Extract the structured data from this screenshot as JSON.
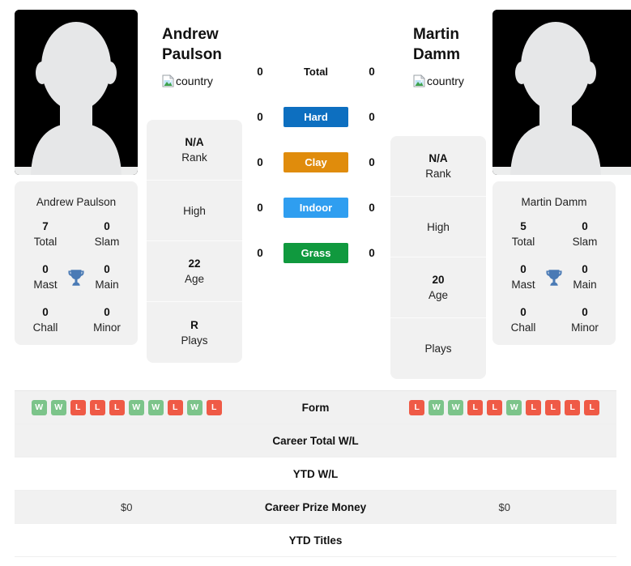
{
  "colors": {
    "hard": "#0d6fc0",
    "clay": "#e08c0c",
    "indoor": "#2f9ef0",
    "grass": "#10993e",
    "win": "#7cc48a",
    "loss": "#ef5a46",
    "trophy": "#4a7ab5",
    "card_bg": "#f1f1f1"
  },
  "players": {
    "left": {
      "name_line1": "Andrew",
      "name_line2": "Paulson",
      "flag_alt": "country",
      "card_name": "Andrew Paulson",
      "titles": [
        {
          "value": "7",
          "label": "Total"
        },
        {
          "value": "0",
          "label": "Slam"
        },
        {
          "value": "0",
          "label": "Mast"
        },
        {
          "value": "0",
          "label": "Main"
        },
        {
          "value": "0",
          "label": "Chall"
        },
        {
          "value": "0",
          "label": "Minor"
        }
      ],
      "info": [
        {
          "value": "N/A",
          "label": "Rank"
        },
        {
          "value": "",
          "label": "High"
        },
        {
          "value": "22",
          "label": "Age"
        },
        {
          "value": "R",
          "label": "Plays"
        }
      ],
      "form": [
        "W",
        "W",
        "L",
        "L",
        "L",
        "W",
        "W",
        "L",
        "W",
        "L"
      ],
      "career_total_wl": "",
      "ytd_wl": "",
      "career_prize_money": "$0",
      "ytd_titles": ""
    },
    "right": {
      "name_line1": "Martin",
      "name_line2": "Damm",
      "flag_alt": "country",
      "card_name": "Martin Damm",
      "titles": [
        {
          "value": "5",
          "label": "Total"
        },
        {
          "value": "0",
          "label": "Slam"
        },
        {
          "value": "0",
          "label": "Mast"
        },
        {
          "value": "0",
          "label": "Main"
        },
        {
          "value": "0",
          "label": "Chall"
        },
        {
          "value": "0",
          "label": "Minor"
        }
      ],
      "info": [
        {
          "value": "N/A",
          "label": "Rank"
        },
        {
          "value": "",
          "label": "High"
        },
        {
          "value": "20",
          "label": "Age"
        },
        {
          "value": "",
          "label": "Plays"
        }
      ],
      "form": [
        "L",
        "W",
        "W",
        "L",
        "L",
        "W",
        "L",
        "L",
        "L",
        "L"
      ],
      "career_total_wl": "",
      "ytd_wl": "",
      "career_prize_money": "$0",
      "ytd_titles": ""
    }
  },
  "surfaces": [
    {
      "label": "Total",
      "left": "0",
      "right": "0",
      "style": "plain"
    },
    {
      "label": "Hard",
      "left": "0",
      "right": "0",
      "style": "hard"
    },
    {
      "label": "Clay",
      "left": "0",
      "right": "0",
      "style": "clay"
    },
    {
      "label": "Indoor",
      "left": "0",
      "right": "0",
      "style": "indoor"
    },
    {
      "label": "Grass",
      "left": "0",
      "right": "0",
      "style": "grass"
    }
  ],
  "table_rows": [
    {
      "label": "Form",
      "kind": "form",
      "shaded": true
    },
    {
      "label": "Career Total W/L",
      "kind": "text",
      "shaded": true,
      "key": "career_total_wl"
    },
    {
      "label": "YTD W/L",
      "kind": "text",
      "shaded": false,
      "key": "ytd_wl"
    },
    {
      "label": "Career Prize Money",
      "kind": "text",
      "shaded": true,
      "key": "career_prize_money"
    },
    {
      "label": "YTD Titles",
      "kind": "text",
      "shaded": false,
      "key": "ytd_titles"
    }
  ]
}
